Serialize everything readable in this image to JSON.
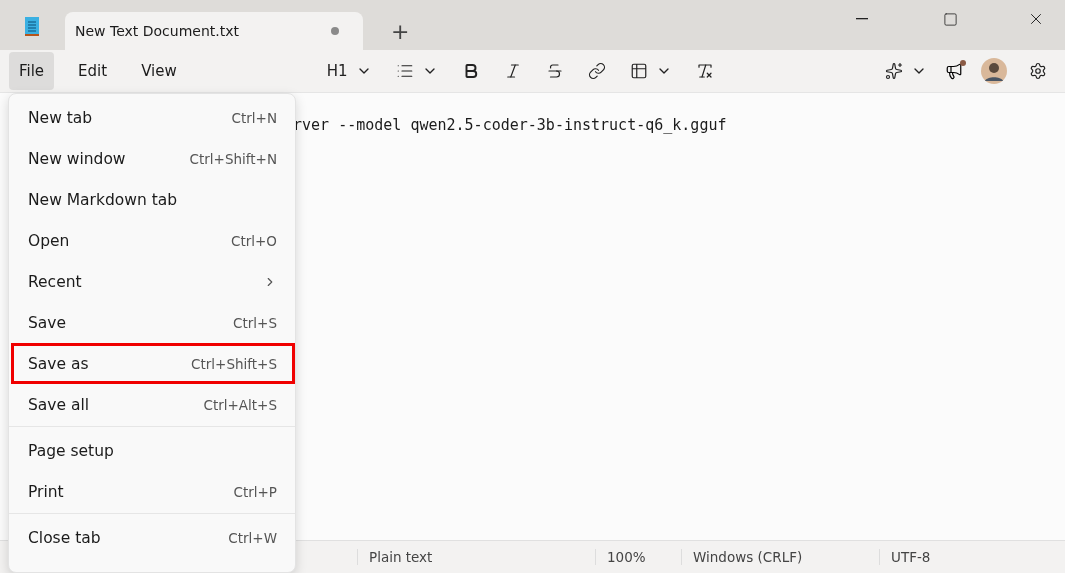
{
  "tab": {
    "title": "New Text Document.txt",
    "unsaved": true,
    "new_tab_label": "+"
  },
  "menubar": [
    {
      "label": "File",
      "selected": true
    },
    {
      "label": "Edit",
      "selected": false
    },
    {
      "label": "View",
      "selected": false
    }
  ],
  "toolbar": {
    "heading": "H1"
  },
  "notification": true,
  "editor": {
    "text": "rver --model qwen2.5-coder-3b-instruct-q6_k.gguf"
  },
  "file_menu": [
    {
      "kind": "item",
      "label": "New tab",
      "shortcut": "Ctrl+N",
      "highlighted": false
    },
    {
      "kind": "item",
      "label": "New window",
      "shortcut": "Ctrl+Shift+N",
      "highlighted": false
    },
    {
      "kind": "item",
      "label": "New Markdown tab",
      "highlighted": false
    },
    {
      "kind": "item",
      "label": "Open",
      "shortcut": "Ctrl+O",
      "highlighted": false
    },
    {
      "kind": "submenu",
      "label": "Recent",
      "highlighted": false
    },
    {
      "kind": "item",
      "label": "Save",
      "shortcut": "Ctrl+S",
      "highlighted": false
    },
    {
      "kind": "item",
      "label": "Save as",
      "shortcut": "Ctrl+Shift+S",
      "highlighted": true
    },
    {
      "kind": "item",
      "label": "Save all",
      "shortcut": "Ctrl+Alt+S",
      "highlighted": false
    },
    {
      "kind": "separator"
    },
    {
      "kind": "item",
      "label": "Page setup",
      "highlighted": false
    },
    {
      "kind": "item",
      "label": "Print",
      "shortcut": "Ctrl+P",
      "highlighted": false
    },
    {
      "kind": "separator"
    },
    {
      "kind": "item",
      "label": "Close tab",
      "shortcut": "Ctrl+W",
      "highlighted": false
    }
  ],
  "status_bar": [
    "Plain text",
    "100%",
    "Windows (CRLF)",
    "UTF-8"
  ]
}
